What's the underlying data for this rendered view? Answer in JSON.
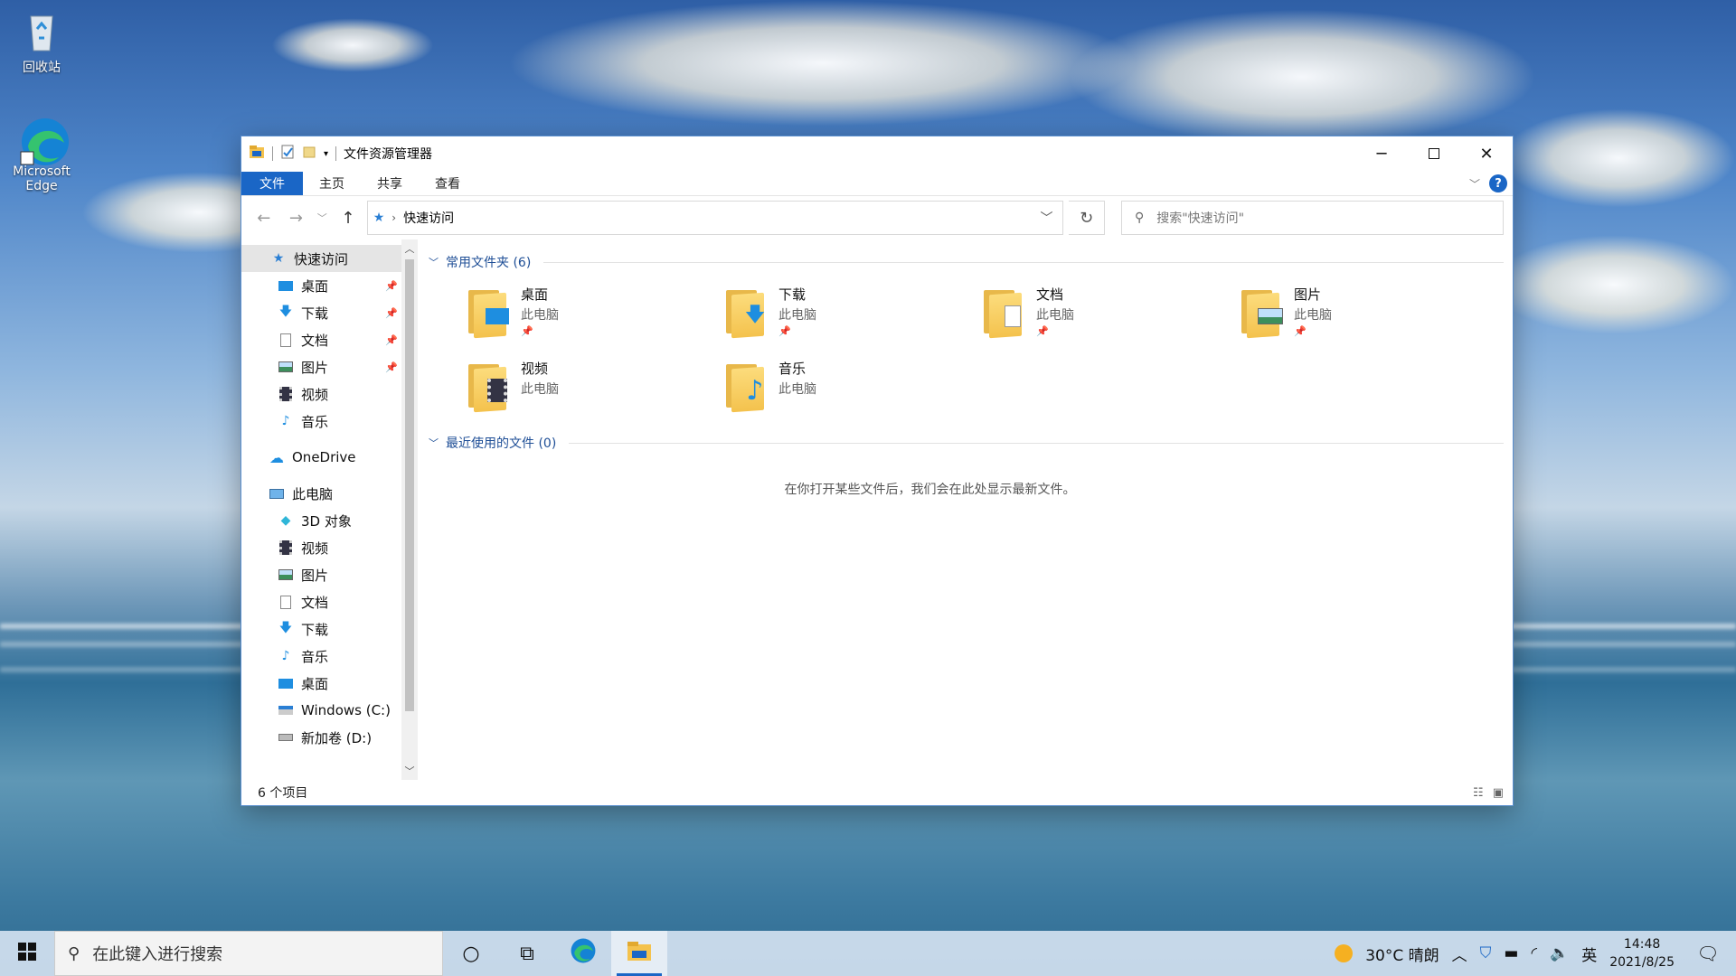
{
  "desktop": {
    "icons": [
      {
        "label": "回收站"
      },
      {
        "label": "Microsoft Edge"
      }
    ]
  },
  "window": {
    "title": "文件资源管理器",
    "ribbon_tabs": [
      "文件",
      "主页",
      "共享",
      "查看"
    ],
    "help_label": "?",
    "address": "快速访问",
    "search_placeholder": "搜索\"快速访问\"",
    "tree": {
      "quick_access": "快速访问",
      "quick_items": [
        "桌面",
        "下载",
        "文档",
        "图片",
        "视频",
        "音乐"
      ],
      "onedrive": "OneDrive",
      "this_pc": "此电脑",
      "pc_items": [
        "3D 对象",
        "视频",
        "图片",
        "文档",
        "下载",
        "音乐",
        "桌面",
        "Windows (C:)",
        "新加卷 (D:)"
      ]
    },
    "frequent": {
      "header": "常用文件夹 (6)",
      "items": [
        {
          "name": "桌面",
          "sub": "此电脑",
          "pinned": true
        },
        {
          "name": "下载",
          "sub": "此电脑",
          "pinned": true
        },
        {
          "name": "文档",
          "sub": "此电脑",
          "pinned": true
        },
        {
          "name": "图片",
          "sub": "此电脑",
          "pinned": true
        },
        {
          "name": "视频",
          "sub": "此电脑",
          "pinned": false
        },
        {
          "name": "音乐",
          "sub": "此电脑",
          "pinned": false
        }
      ]
    },
    "recent": {
      "header": "最近使用的文件 (0)",
      "empty": "在你打开某些文件后，我们会在此处显示最新文件。"
    },
    "status": "6 个项目"
  },
  "taskbar": {
    "search_placeholder": "在此键入进行搜索",
    "weather": "30°C  晴朗",
    "ime": "英",
    "time": "14:48",
    "date": "2021/8/25"
  },
  "colors": {
    "accent": "#1a66c6",
    "folder": "#f4c24d"
  }
}
